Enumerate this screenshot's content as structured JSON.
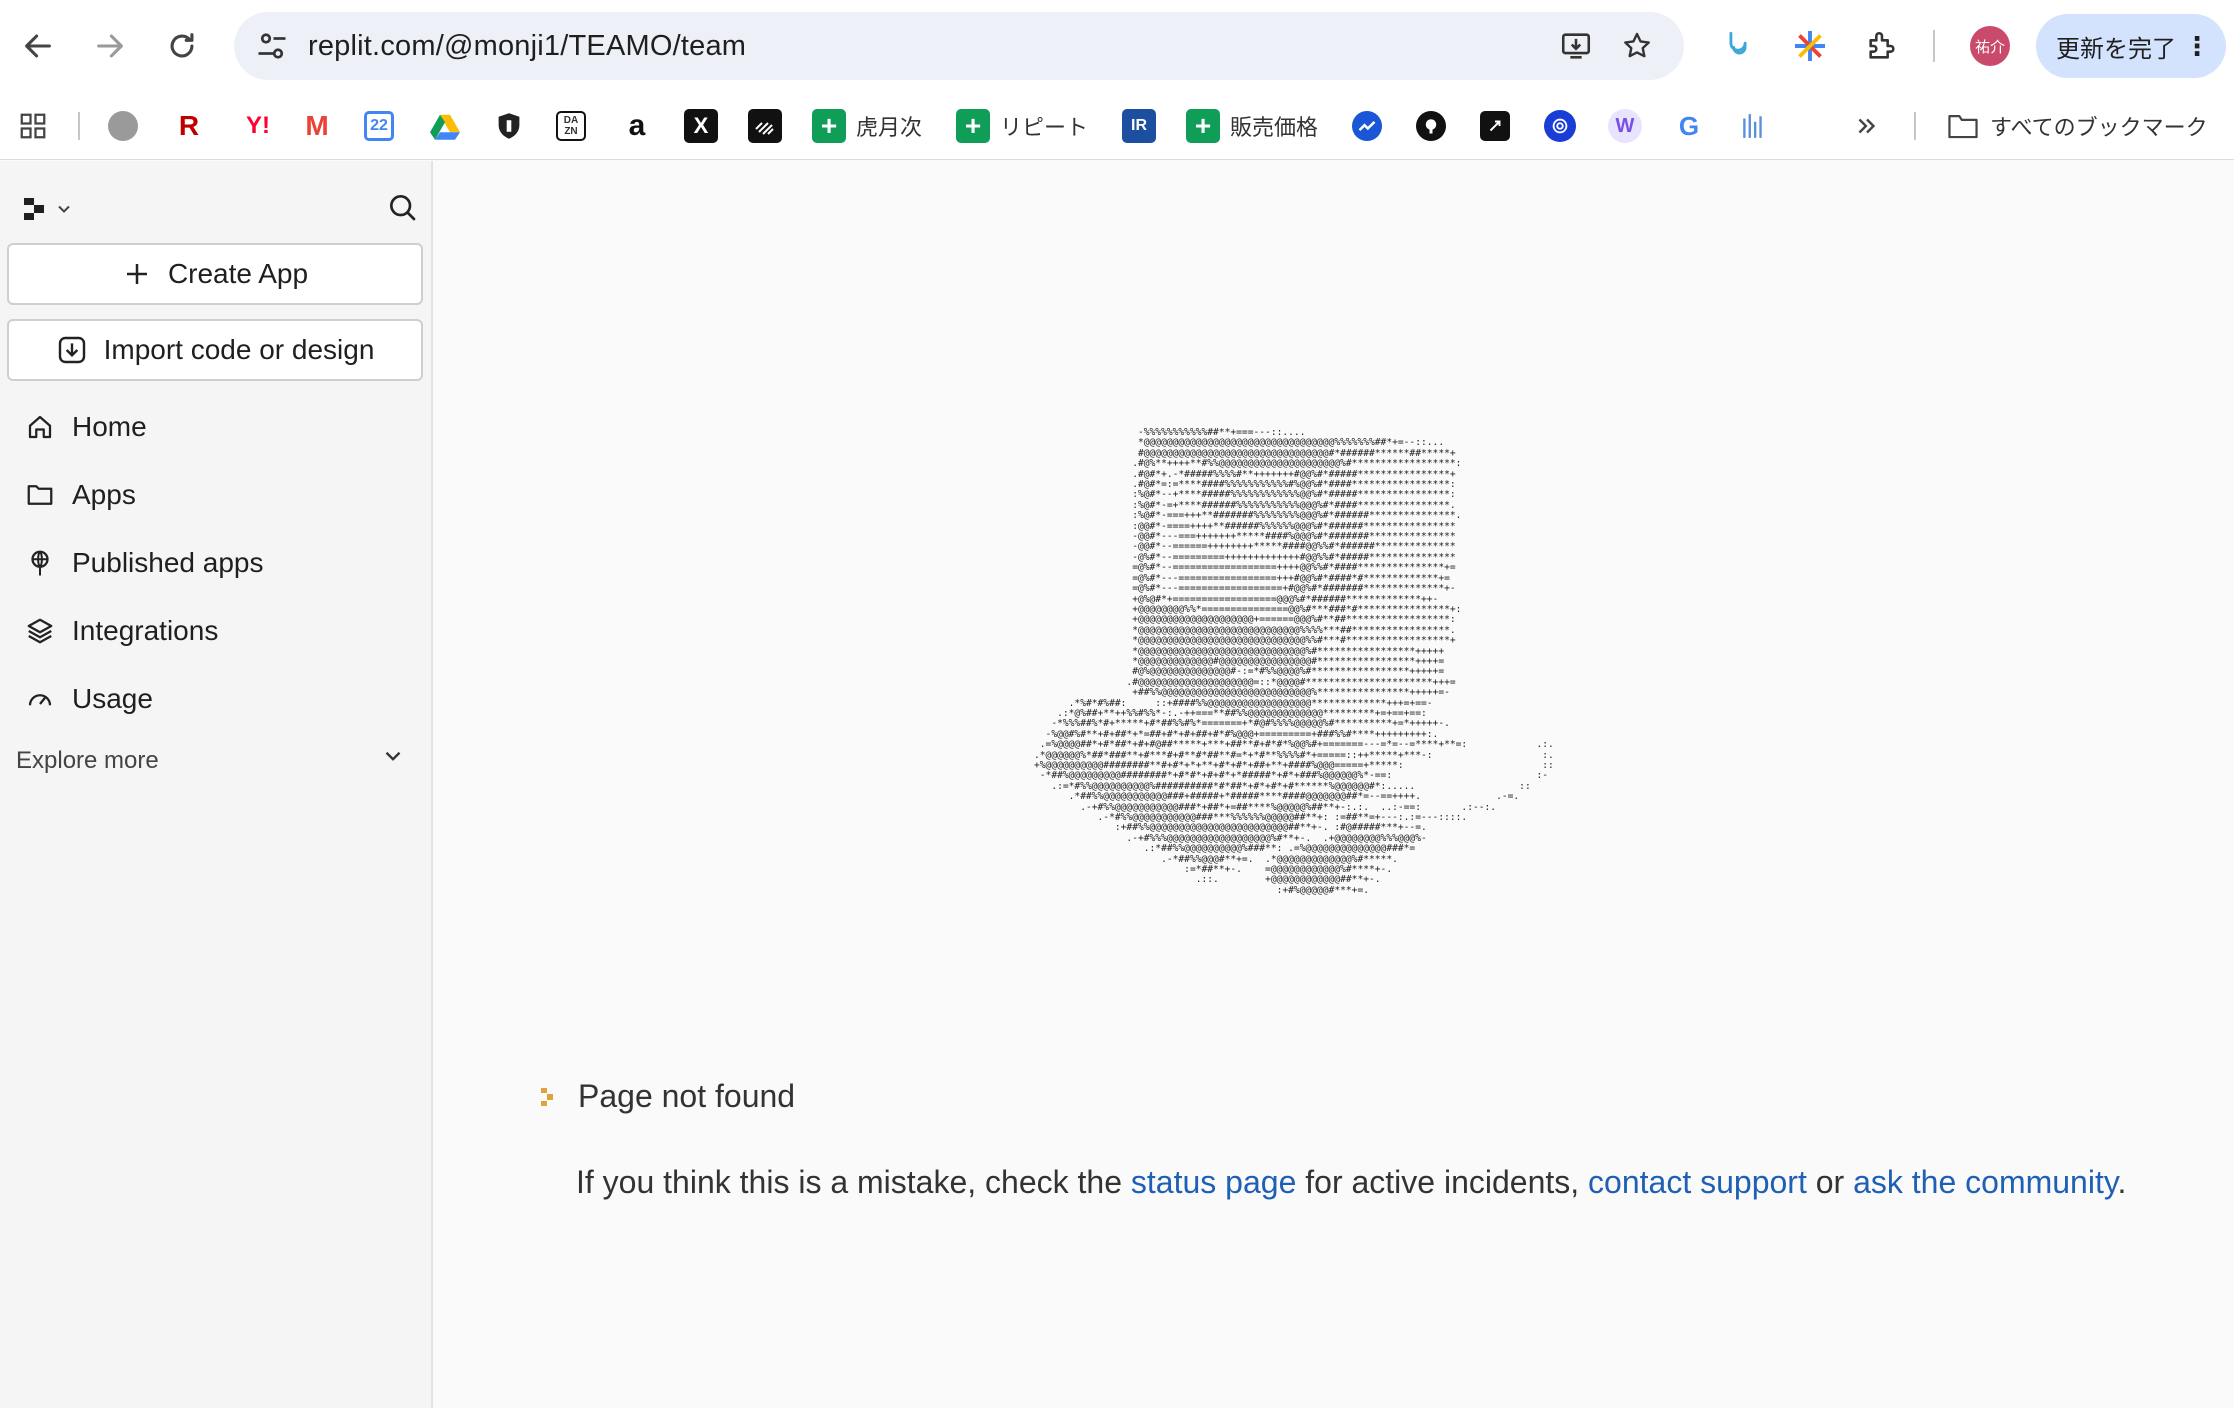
{
  "browser": {
    "url": "replit.com/@monji1/TEAMO/team",
    "avatar_text": "祐介",
    "update_button": "更新を完了",
    "accent": "#d3e3fd"
  },
  "bookmarks": {
    "items": [
      {
        "name": "apps-grid",
        "label": ""
      },
      {
        "name": "octopus",
        "label": ""
      },
      {
        "name": "rakuten",
        "label": "R"
      },
      {
        "name": "yahoo",
        "label": "Y!"
      },
      {
        "name": "gmail",
        "label": "M"
      },
      {
        "name": "calendar",
        "label": "22"
      },
      {
        "name": "drive",
        "label": ""
      },
      {
        "name": "shield",
        "label": ""
      },
      {
        "name": "dazn",
        "label": "DAZN"
      },
      {
        "name": "amazon",
        "label": "a"
      },
      {
        "name": "x",
        "label": "X"
      },
      {
        "name": "stripe-like",
        "label": ""
      },
      {
        "name": "sheet-1",
        "label": "虎月次"
      },
      {
        "name": "sheet-2",
        "label": "リピート"
      },
      {
        "name": "irbank",
        "label": "IR"
      },
      {
        "name": "sheet-3",
        "label": "販売価格"
      },
      {
        "name": "chart",
        "label": ""
      },
      {
        "name": "github",
        "label": ""
      },
      {
        "name": "terminal",
        "label": ""
      },
      {
        "name": "openai",
        "label": ""
      },
      {
        "name": "w",
        "label": "W"
      },
      {
        "name": "google",
        "label": "G"
      },
      {
        "name": "chart-2",
        "label": ""
      }
    ],
    "all_bookmarks": "すべてのブックマーク"
  },
  "sidebar": {
    "create_app": "Create App",
    "import_code": "Import code or design",
    "nav": [
      {
        "label": "Home",
        "icon": "home-icon"
      },
      {
        "label": "Apps",
        "icon": "folder-icon"
      },
      {
        "label": "Published apps",
        "icon": "globe-icon"
      },
      {
        "label": "Integrations",
        "icon": "layers-icon"
      },
      {
        "label": "Usage",
        "icon": "gauge-icon"
      }
    ],
    "explore_more": "Explore more"
  },
  "main": {
    "not_found": "Page not found",
    "message_prefix": "If you think this is a mistake, check the ",
    "status_link": "status page",
    "message_mid": " for active incidents, ",
    "contact_link": "contact support",
    "message_or": " or ",
    "community_link": "ask the community",
    "message_end": "."
  }
}
